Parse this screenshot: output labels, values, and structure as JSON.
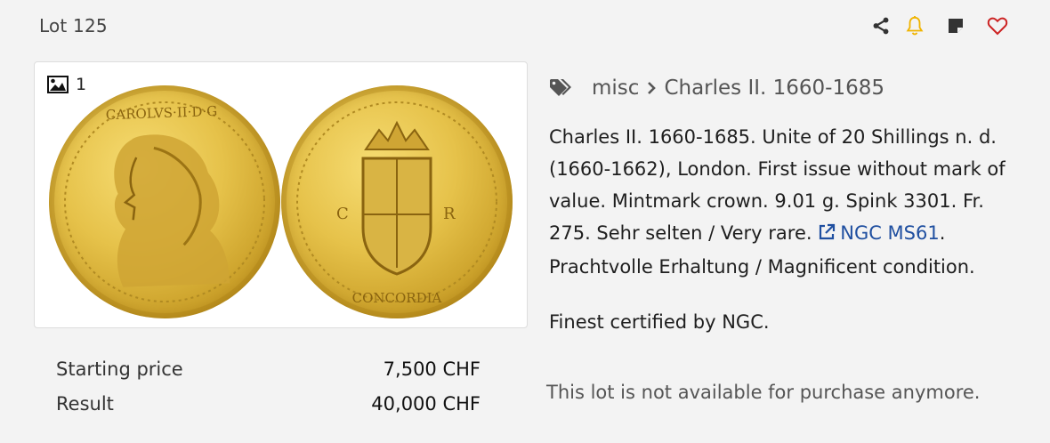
{
  "header": {
    "lot_title": "Lot 125",
    "actions": [
      {
        "icon": "share-icon",
        "color": "#333333"
      },
      {
        "icon": "bell-icon",
        "color": "#f0b400"
      },
      {
        "icon": "note-icon",
        "color": "#333333"
      },
      {
        "icon": "heart-icon",
        "color": "#cc2222"
      }
    ]
  },
  "gallery": {
    "image_count": "1",
    "coin_images": [
      "obverse",
      "reverse"
    ]
  },
  "prices": {
    "starting_label": "Starting price",
    "starting_value": "7,500 CHF",
    "result_label": "Result",
    "result_value": "40,000 CHF"
  },
  "breadcrumb": {
    "category": "misc",
    "subcategory": "Charles II. 1660-1685"
  },
  "description": {
    "text_before_link": "Charles II. 1660-1685. Unite of 20 Shillings n. d. (1660-1662), London. First issue without mark of value. Mintmark crown. 9.01 g. Spink 3301. Fr. 275. Sehr selten / Very rare. ",
    "link_text": "NGC MS61",
    "text_after_link": ". Prachtvolle Erhaltung / Magnificent condition.",
    "finest": "Finest certified by NGC.",
    "availability": "This lot is not available for purchase anymore."
  },
  "colors": {
    "background": "#f3f3f3",
    "link": "#1f4fa0",
    "gold": "#e6c24a"
  }
}
